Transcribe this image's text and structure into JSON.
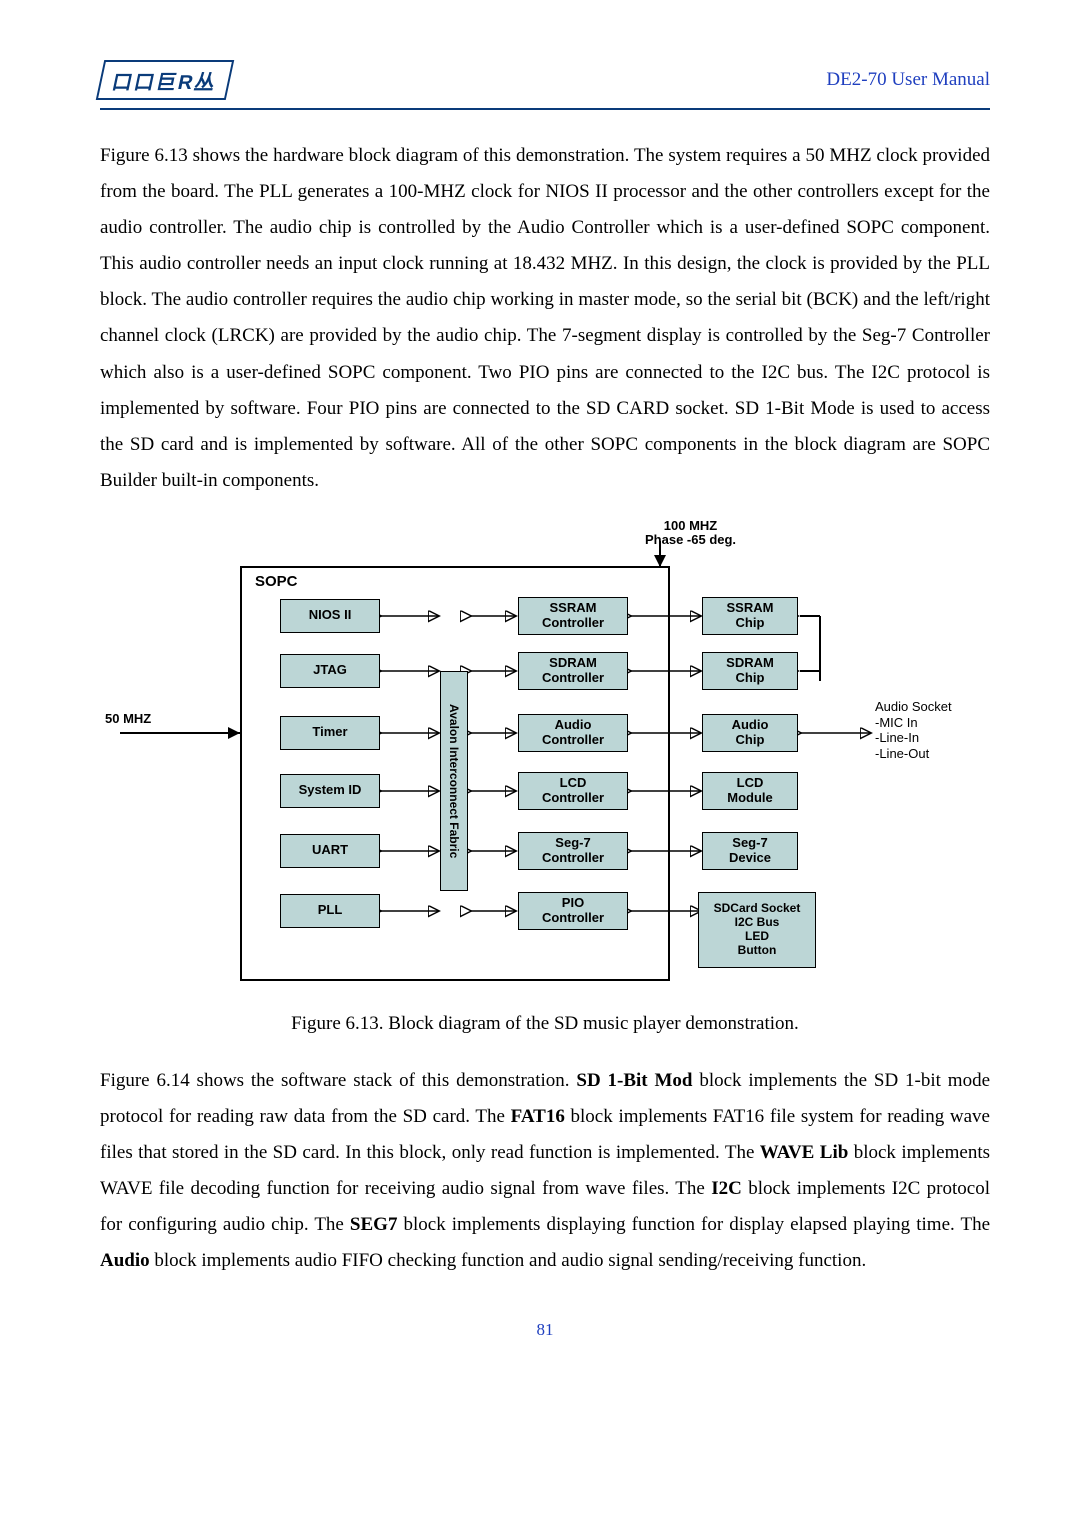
{
  "header": {
    "logo_text": "口口巨R丛",
    "manual": "DE2-70 User Manual"
  },
  "para1": "Figure 6.13 shows the hardware block diagram of this demonstration. The system requires a 50 MHZ clock provided from the board. The PLL generates a 100-MHZ clock for NIOS II processor and the other controllers except for the audio controller. The audio chip is controlled by the Audio Controller which is a user-defined SOPC component. This audio controller needs an input clock running at 18.432 MHZ. In this design, the clock is provided by the PLL block. The audio controller requires the audio chip working in master mode, so the serial bit (BCK) and the left/right channel clock (LRCK) are provided by the audio chip. The 7-segment display is controlled by the Seg-7 Controller which also is a user-defined SOPC component. Two PIO pins are connected to the I2C bus. The I2C protocol is implemented by software. Four PIO pins are connected to the SD CARD socket. SD 1-Bit Mode is used to access the SD card and is implemented by software. All of the other SOPC components in the block diagram are SOPC Builder built-in components.",
  "figure_caption": "Figure 6.13.   Block diagram of the SD music player demonstration.",
  "para2_parts": {
    "a": "Figure 6.14 shows the software stack of this demonstration. ",
    "b": "SD 1-Bit Mod",
    "c": " block implements the SD 1-bit mode protocol for reading raw data from the SD card. The ",
    "d": "FAT16",
    "e": " block implements FAT16 file system for reading wave files that stored in the SD card. In this block, only read function is implemented. The ",
    "f": "WAVE Lib",
    "g": " block implements WAVE file decoding function for receiving audio signal from wave files. The ",
    "h": "I2C",
    "i": " block implements I2C protocol for configuring audio chip. The ",
    "j": "SEG7",
    "k": " block implements displaying function for display elapsed playing time. The ",
    "l": "Audio",
    "m": " block implements audio FIFO checking function and audio signal sending/receiving function."
  },
  "page_number": "81",
  "chart_data": {
    "type": "block-diagram",
    "labels": {
      "clk_top": "100 MHZ\nPhase -65 deg.",
      "clk_left": "50 MHZ",
      "sopc": "SOPC",
      "bus": "Avalon Interconnect Fabric",
      "audio_socket": "Audio Socket\n-MIC In\n-Line-In\n-Line-Out"
    },
    "left_column": [
      "NIOS II",
      "JTAG",
      "Timer",
      "System ID",
      "UART",
      "PLL"
    ],
    "mid_column": [
      "SSRAM\nController",
      "SDRAM\nController",
      "Audio\nController",
      "LCD\nController",
      "Seg-7\nController",
      "PIO\nController"
    ],
    "right_column": [
      "SSRAM\nChip",
      "SDRAM\nChip",
      "Audio\nChip",
      "LCD\nModule",
      "Seg-7\nDevice",
      "SDCard Socket\nI2C Bus\nLED\nButton"
    ]
  }
}
